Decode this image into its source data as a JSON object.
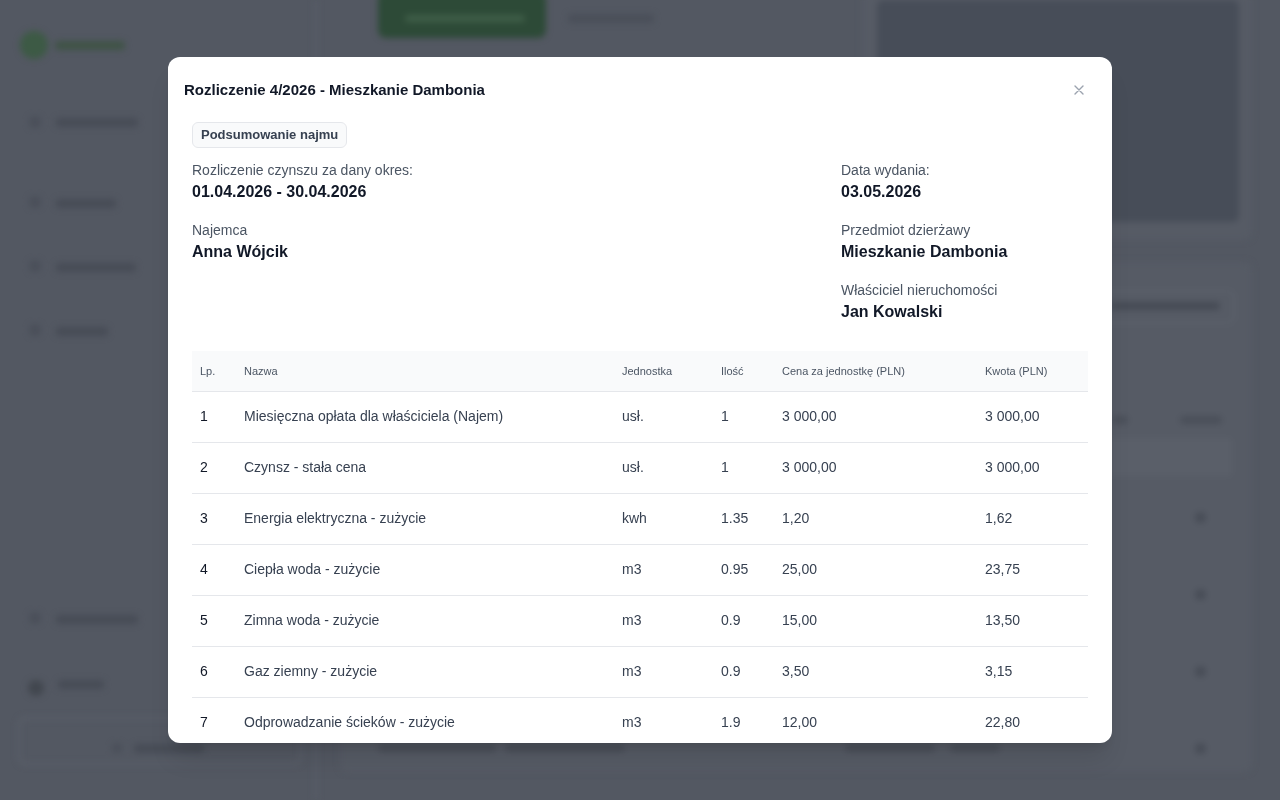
{
  "dialog": {
    "title": "Rozliczenie 4/2026 - Mieszkanie Dambonia"
  },
  "tabs": [
    {
      "label": "Podsumowanie najmu",
      "selected": true
    }
  ],
  "details_left": [
    {
      "label": "Rozliczenie czynszu za dany okres:",
      "value": "01.04.2026 - 30.04.2026"
    },
    {
      "label": "Najemca",
      "value": "Anna Wójcik"
    }
  ],
  "details_right": [
    {
      "label": "Data wydania:",
      "value": "03.05.2026"
    },
    {
      "label": "Przedmiot dzierżawy",
      "value": "Mieszkanie Dambonia"
    },
    {
      "label": "Właściciel nieruchomości",
      "value": "Jan Kowalski"
    }
  ],
  "table": {
    "columns": [
      "Lp.",
      "Nazwa",
      "Jednostka",
      "Ilość",
      "Cena za jednostkę (PLN)",
      "Kwota (PLN)"
    ],
    "rows": [
      [
        "1",
        "Miesięczna opłata dla właściciela (Najem)",
        "usł.",
        "1",
        "3 000,00",
        "3 000,00"
      ],
      [
        "2",
        "Czynsz - stała cena",
        "usł.",
        "1",
        "3 000,00",
        "3 000,00"
      ],
      [
        "3",
        "Energia elektryczna - zużycie",
        "kwh",
        "1.35",
        "1,20",
        "1,62"
      ],
      [
        "4",
        "Ciepła woda - zużycie",
        "m3",
        "0.95",
        "25,00",
        "23,75"
      ],
      [
        "5",
        "Zimna woda - zużycie",
        "m3",
        "0.9",
        "15,00",
        "13,50"
      ],
      [
        "6",
        "Gaz ziemny - zużycie",
        "m3",
        "0.9",
        "3,50",
        "3,15"
      ],
      [
        "7",
        "Odprowadzanie ścieków - zużycie",
        "m3",
        "1.9",
        "12,00",
        "22,80"
      ]
    ]
  }
}
